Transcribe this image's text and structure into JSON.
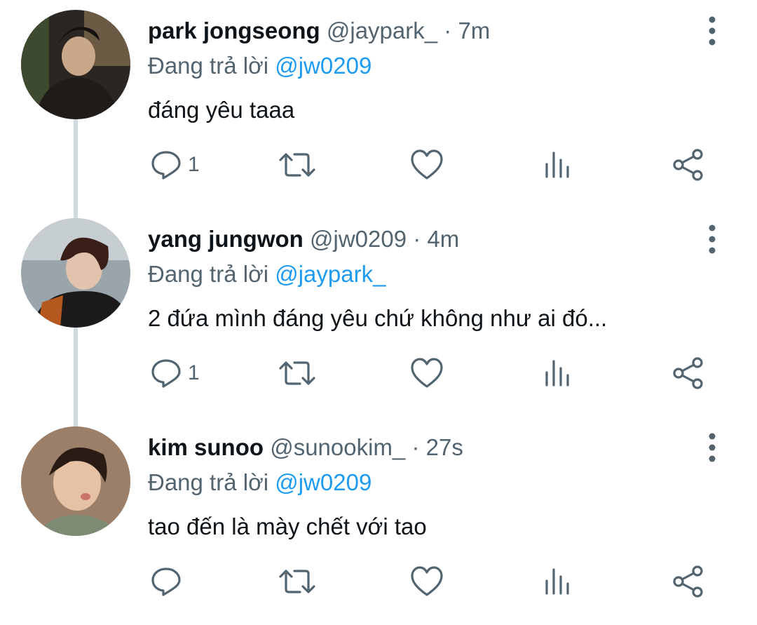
{
  "tweets": [
    {
      "name": "park jongseong",
      "handle": "@jaypark_",
      "time": "7m",
      "reply_prefix": "Đang trả lời",
      "reply_to": "@jw0209",
      "text": "đáng yêu taaa",
      "reply_count": "1"
    },
    {
      "name": "yang jungwon",
      "handle": "@jw0209",
      "time": "4m",
      "reply_prefix": "Đang trả lời",
      "reply_to": "@jaypark_",
      "text": "2 đứa mình đáng yêu chứ không như ai đó...",
      "reply_count": "1"
    },
    {
      "name": "kim sunoo",
      "handle": "@sunookim_",
      "time": "27s",
      "reply_prefix": "Đang trả lời",
      "reply_to": "@jw0209",
      "text": "tao đến là mày chết với tao",
      "reply_count": ""
    }
  ],
  "separator": " · ",
  "icons": [
    "more-vertical-icon",
    "reply-icon",
    "retweet-icon",
    "like-icon",
    "analytics-icon",
    "share-icon"
  ],
  "colors": {
    "link": "#1d9bf0",
    "muted": "#536471",
    "text": "#0f1419",
    "thread_line": "#cfd9de"
  }
}
